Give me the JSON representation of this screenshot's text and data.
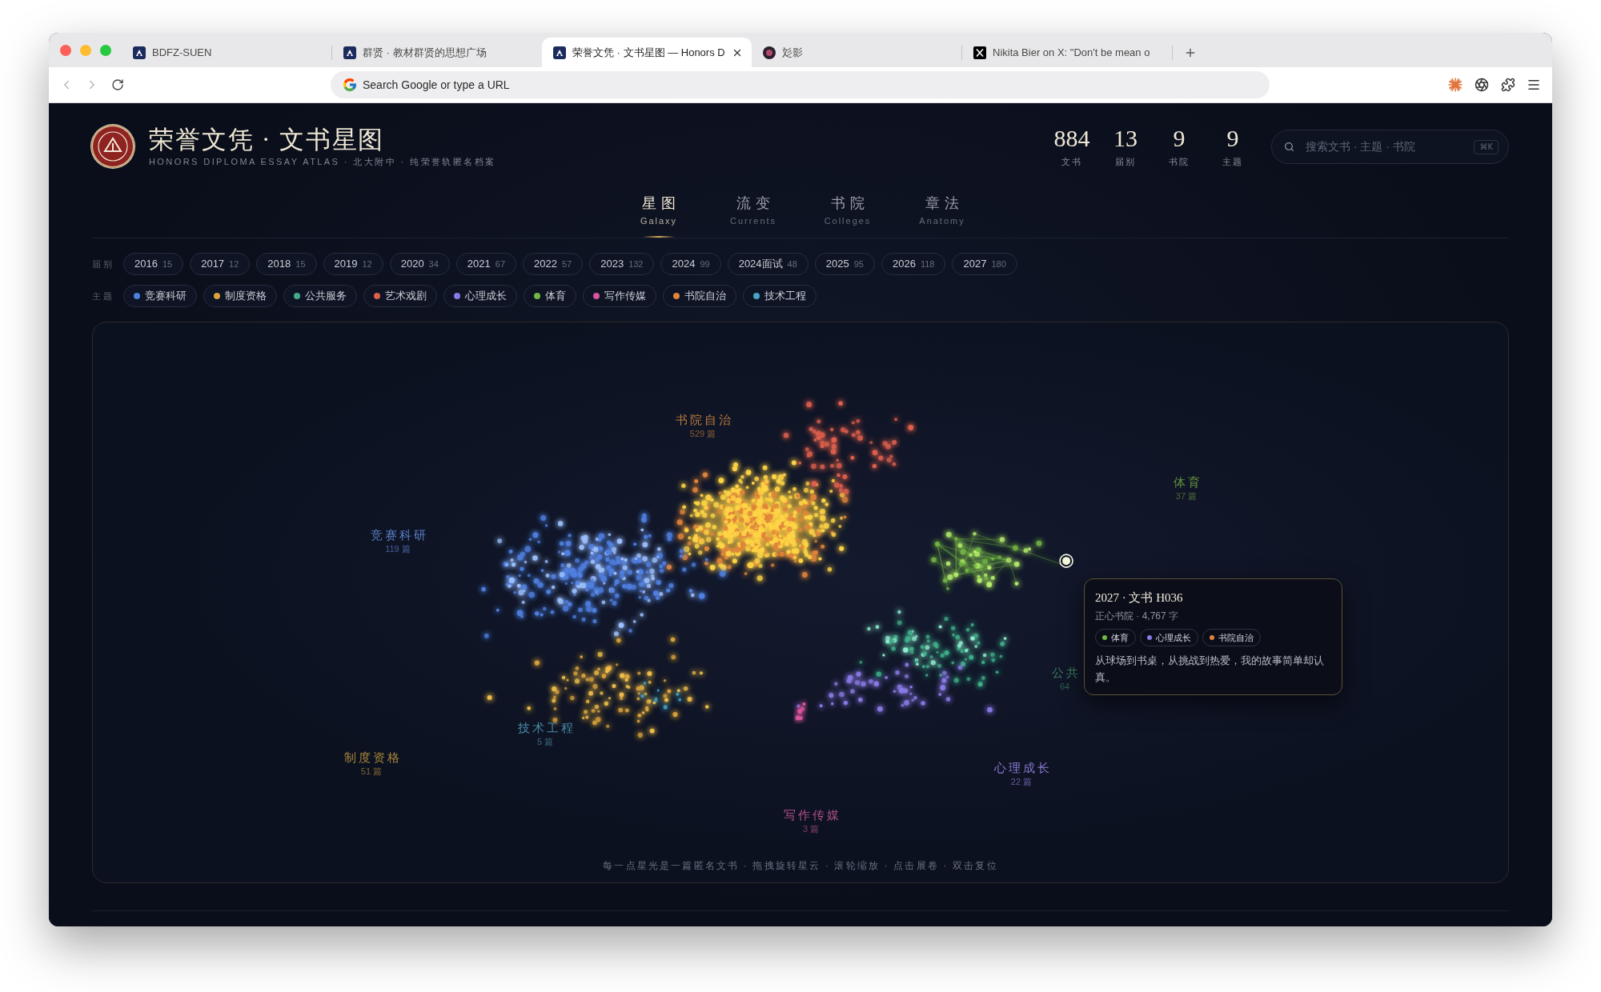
{
  "browser": {
    "tabs": [
      {
        "title": "BDFZ-SUEN",
        "kind": "square",
        "selected": false
      },
      {
        "title": "群贤 · 教材群贤的思想广场",
        "kind": "square",
        "selected": false
      },
      {
        "title": "荣誉文凭 · 文书星图 — Honors D",
        "kind": "square",
        "selected": true
      },
      {
        "title": "彣影",
        "kind": "circle",
        "selected": false
      },
      {
        "title": "Nikita Bier on X: \"Don't be mean o",
        "kind": "x",
        "selected": false
      }
    ],
    "back": {
      "disabled": true
    },
    "forward": {
      "disabled": true
    },
    "address": {
      "placeholder": "Search Google or type a URL"
    }
  },
  "header": {
    "title": "荣誉文凭 · 文书星图",
    "subtitle": "HONORS DIPLOMA ESSAY ATLAS · 北大附中 · 纯荣誉轨匿名档案",
    "stats": [
      {
        "value": "884",
        "label": "文书"
      },
      {
        "value": "13",
        "label": "届别"
      },
      {
        "value": "9",
        "label": "书院"
      },
      {
        "value": "9",
        "label": "主题"
      }
    ],
    "search": {
      "placeholder": "搜索文书 · 主题 · 书院",
      "shortcut": "⌘K"
    }
  },
  "nav": [
    {
      "label": "星图",
      "sublabel": "Galaxy",
      "selected": true
    },
    {
      "label": "流变",
      "sublabel": "Currents",
      "selected": false
    },
    {
      "label": "书院",
      "sublabel": "Colleges",
      "selected": false
    },
    {
      "label": "章法",
      "sublabel": "Anatomy",
      "selected": false
    }
  ],
  "filters": {
    "years": {
      "label": "届别",
      "items": [
        {
          "year": "2016",
          "count": "15"
        },
        {
          "year": "2017",
          "count": "12"
        },
        {
          "year": "2018",
          "count": "15"
        },
        {
          "year": "2019",
          "count": "12"
        },
        {
          "year": "2020",
          "count": "34"
        },
        {
          "year": "2021",
          "count": "67"
        },
        {
          "year": "2022",
          "count": "57"
        },
        {
          "year": "2023",
          "count": "132"
        },
        {
          "year": "2024",
          "count": "99"
        },
        {
          "year": "2024面试",
          "count": "48"
        },
        {
          "year": "2025",
          "count": "95"
        },
        {
          "year": "2026",
          "count": "118"
        },
        {
          "year": "2027",
          "count": "180"
        }
      ]
    },
    "themes": {
      "label": "主题",
      "items": [
        {
          "label": "竞赛科研",
          "color": "#4f7fe0"
        },
        {
          "label": "制度资格",
          "color": "#d9a23a"
        },
        {
          "label": "公共服务",
          "color": "#3fae88"
        },
        {
          "label": "艺术戏剧",
          "color": "#e0604c"
        },
        {
          "label": "心理成长",
          "color": "#8a7ae6"
        },
        {
          "label": "体育",
          "color": "#74b844"
        },
        {
          "label": "写作传媒",
          "color": "#d8549c"
        },
        {
          "label": "书院自治",
          "color": "#e0843a"
        },
        {
          "label": "技术工程",
          "color": "#46a4c4"
        }
      ]
    }
  },
  "galaxy": {
    "clusters": [
      {
        "label": "书院自治",
        "count": "529 篇",
        "color": "#b87a3c"
      },
      {
        "label": "竞赛科研",
        "count": "119 篇",
        "color": "#5b80c8"
      },
      {
        "label": "体育",
        "count": "37 篇",
        "color": "#638f3c"
      },
      {
        "label": "技术工程",
        "count": "5 篇",
        "color": "#4a8aa6"
      },
      {
        "label": "制度资格",
        "count": "51 篇",
        "color": "#a88838"
      },
      {
        "label": "心理成长",
        "count": "22 篇",
        "color": "#8878d0"
      },
      {
        "label": "写作传媒",
        "count": "3 篇",
        "color": "#b0508a"
      },
      {
        "label": "公共",
        "count": "64",
        "color": "#3f7d62"
      }
    ],
    "tooltip": {
      "title": "2027 · 文书 H036",
      "meta": "正心书院 · 4,767 字",
      "tags": [
        {
          "label": "体育",
          "color": "#74b844"
        },
        {
          "label": "心理成长",
          "color": "#8a7ae6"
        },
        {
          "label": "书院自治",
          "color": "#e0843a"
        }
      ],
      "excerpt": "从球场到书桌，从挑战到热爱，我的故事简单却认真。"
    },
    "hint": "每一点星光是一篇匿名文书 · 拖拽旋转星云 · 滚轮缩放 · 点击展卷 · 双击复位"
  }
}
